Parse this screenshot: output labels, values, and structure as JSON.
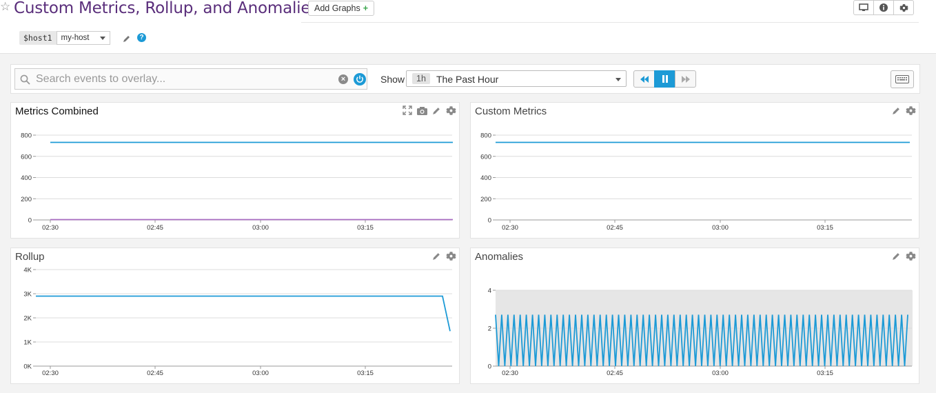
{
  "header": {
    "title": "Custom Metrics, Rollup, and Anomalies",
    "add_graphs": "Add Graphs",
    "add_graphs_plus": "+",
    "star_icon": "star-icon",
    "buttons": [
      "monitor-icon",
      "info-icon",
      "gear-icon"
    ]
  },
  "template_variable": {
    "name": "$host1",
    "value": "my-host"
  },
  "events": {
    "search_placeholder": "Search events to overlay...",
    "show_label": "Show",
    "time_badge": "1h",
    "time_text": "The Past Hour"
  },
  "colors": {
    "accent": "#1c9ad6",
    "title": "#5a2e7b",
    "series_primary": "#1c9ad6",
    "series_secondary": "#a86cc1",
    "anomaly_band": "#e6e6e6"
  },
  "widgets": [
    {
      "title": "Metrics Combined",
      "tools": [
        "expand-icon",
        "camera-icon",
        "pencil-icon",
        "gear-icon"
      ]
    },
    {
      "title": "Custom Metrics",
      "tools": [
        "pencil-icon",
        "gear-icon"
      ]
    },
    {
      "title": "Rollup",
      "tools": [
        "pencil-icon",
        "gear-icon"
      ]
    },
    {
      "title": "Anomalies",
      "tools": [
        "pencil-icon",
        "gear-icon"
      ]
    }
  ],
  "chart_data": [
    {
      "type": "line",
      "title": "Metrics Combined",
      "x_ticks": [
        "02:30",
        "02:45",
        "03:00",
        "03:15"
      ],
      "y_ticks": [
        "800",
        "600",
        "400",
        "200",
        "0"
      ],
      "ylim": [
        0,
        800
      ],
      "grid": true,
      "series": [
        {
          "color": "#1c9ad6",
          "values": [
            732,
            732,
            732,
            732,
            732,
            732,
            732,
            732,
            732,
            732,
            732,
            732
          ]
        },
        {
          "color": "#a86cc1",
          "values": [
            3,
            3,
            3,
            3,
            3,
            3,
            3,
            3,
            3,
            3,
            3,
            3
          ]
        }
      ]
    },
    {
      "type": "line",
      "title": "Custom Metrics",
      "x_ticks": [
        "02:30",
        "02:45",
        "03:00",
        "03:15"
      ],
      "y_ticks": [
        "800",
        "600",
        "400",
        "200",
        "0"
      ],
      "ylim": [
        0,
        800
      ],
      "grid": true,
      "series": [
        {
          "color": "#1c9ad6",
          "values": [
            732,
            732,
            732,
            732,
            732,
            732,
            732,
            732,
            732,
            732,
            732,
            732
          ]
        }
      ]
    },
    {
      "type": "line",
      "title": "Rollup",
      "x_ticks": [
        "02:30",
        "02:45",
        "03:00",
        "03:15"
      ],
      "y_ticks": [
        "4K",
        "3K",
        "2K",
        "1K",
        "0K"
      ],
      "ylim": [
        0,
        4000
      ],
      "grid": true,
      "series": [
        {
          "color": "#1c9ad6",
          "values": [
            2900,
            2900,
            2900,
            2900,
            2900,
            2900,
            2900,
            2900,
            2900,
            2900,
            2900,
            2900,
            1450
          ]
        }
      ]
    },
    {
      "type": "line",
      "title": "Anomalies",
      "x_ticks": [
        "02:30",
        "02:45",
        "03:00",
        "03:15"
      ],
      "y_ticks": [
        "4",
        "2",
        "0"
      ],
      "ylim": [
        0,
        4.2
      ],
      "grid": true,
      "bounds_band": [
        0,
        4.2
      ],
      "series": [
        {
          "color": "#1c9ad6",
          "pattern": "sawtooth",
          "low": 0,
          "high": 2.85,
          "cycles": 67
        }
      ]
    }
  ]
}
